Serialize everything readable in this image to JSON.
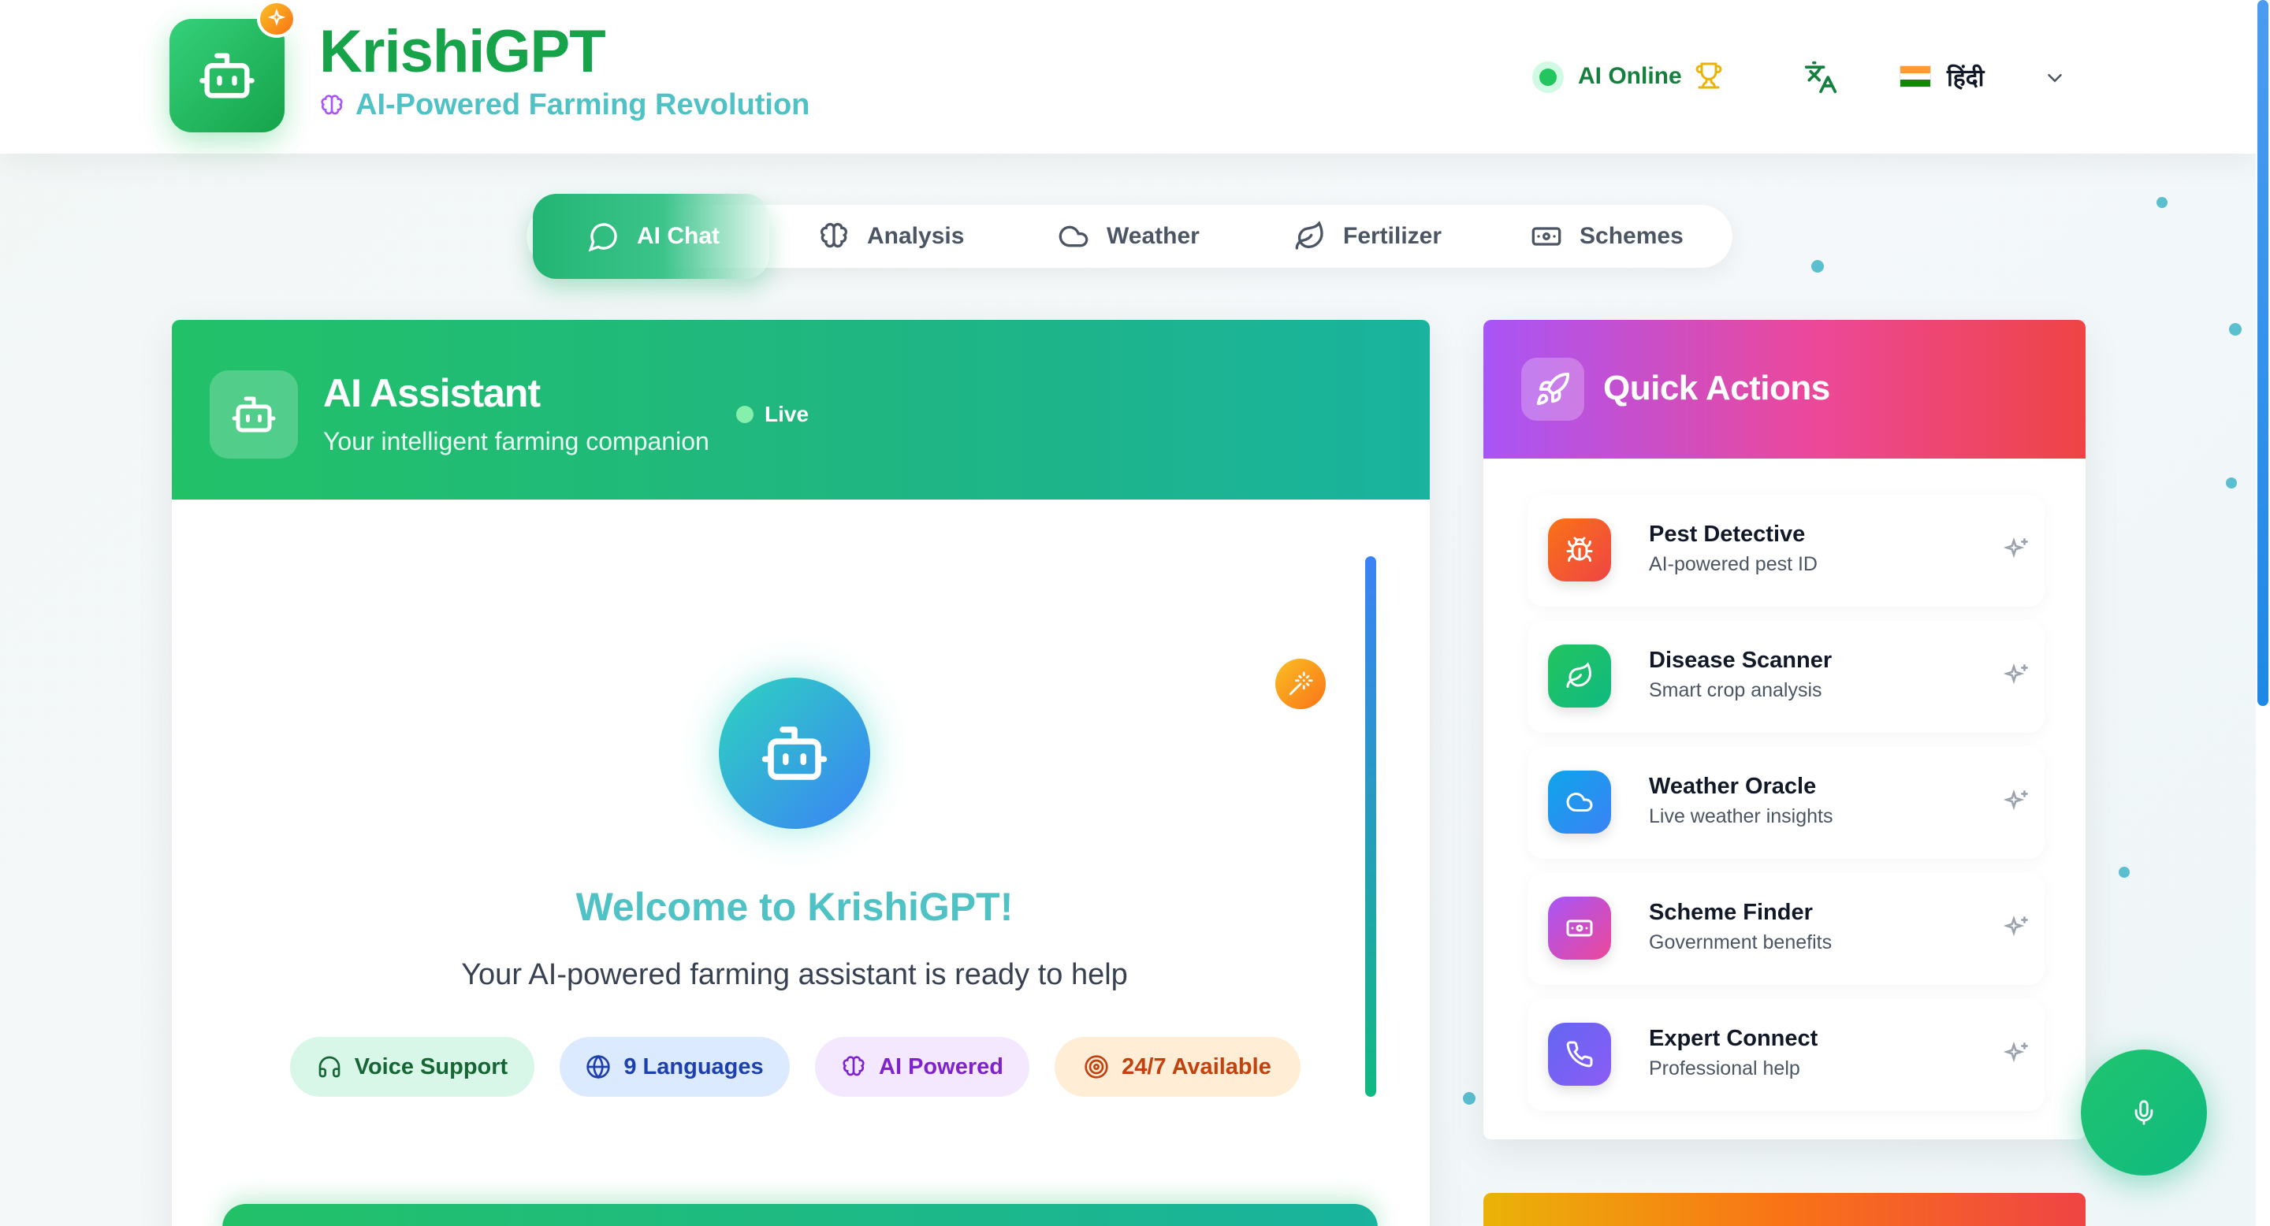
{
  "header": {
    "brand_title": "KrishiGPT",
    "brand_subtitle": "AI-Powered Farming Revolution",
    "status_text": "AI Online",
    "language": "हिंदी"
  },
  "tabs": [
    {
      "label": "AI Chat",
      "icon": "chat-bubble-icon",
      "active": true
    },
    {
      "label": "Analysis",
      "icon": "brain-icon",
      "active": false
    },
    {
      "label": "Weather",
      "icon": "cloud-icon",
      "active": false
    },
    {
      "label": "Fertilizer",
      "icon": "leaf-icon",
      "active": false
    },
    {
      "label": "Schemes",
      "icon": "banknote-icon",
      "active": false
    }
  ],
  "chat": {
    "title": "AI Assistant",
    "subtitle": "Your intelligent farming companion",
    "live_label": "Live",
    "welcome_title": "Welcome to KrishiGPT!",
    "welcome_subtitle": "Your AI-powered farming assistant is ready to help",
    "features": [
      {
        "label": "Voice Support",
        "icon": "headphones-icon"
      },
      {
        "label": "9 Languages",
        "icon": "globe-icon"
      },
      {
        "label": "AI Powered",
        "icon": "brain-icon"
      },
      {
        "label": "24/7 Available",
        "icon": "target-icon"
      }
    ]
  },
  "quick_actions": {
    "title": "Quick Actions",
    "items": [
      {
        "title": "Pest Detective",
        "subtitle": "AI-powered pest ID",
        "icon": "bug-icon"
      },
      {
        "title": "Disease Scanner",
        "subtitle": "Smart crop analysis",
        "icon": "leaf-icon"
      },
      {
        "title": "Weather Oracle",
        "subtitle": "Live weather insights",
        "icon": "cloud-icon"
      },
      {
        "title": "Scheme Finder",
        "subtitle": "Government benefits",
        "icon": "banknote-icon"
      },
      {
        "title": "Expert Connect",
        "subtitle": "Professional help",
        "icon": "phone-icon"
      }
    ]
  },
  "colors": {
    "primary_green": "#16a34a",
    "accent_teal": "#4ec2c4",
    "quick_actions_gradient": [
      "#a855f7",
      "#ec4899",
      "#ef4444"
    ]
  }
}
